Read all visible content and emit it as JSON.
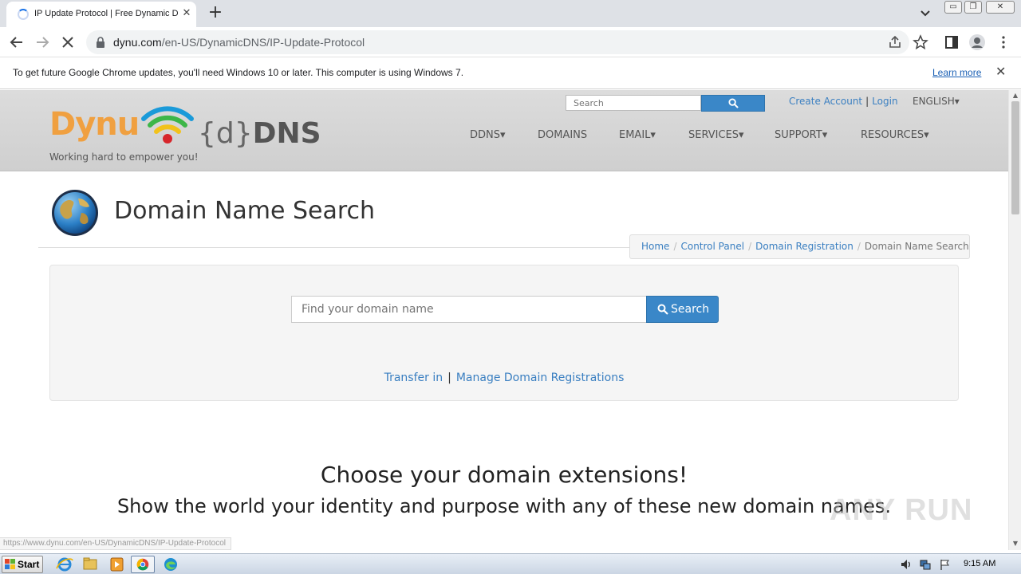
{
  "browser": {
    "tab_title": "IP Update Protocol | Free Dynamic D",
    "tab_close": "✕",
    "new_tab": "+",
    "url_host": "dynu.com",
    "url_path": "/en-US/DynamicDNS/IP-Update-Protocol",
    "window_controls": [
      "▭",
      "❐",
      "✕"
    ]
  },
  "infobar": {
    "message": "To get future Google Chrome updates, you'll need Windows 10 or later. This computer is using Windows 7.",
    "learn_more": "Learn more",
    "close": "✕"
  },
  "site": {
    "logo_word": "Dynu",
    "logo_ddns_braces": "{d}",
    "logo_ddns_text": "DNS",
    "tagline": "Working hard to empower you!",
    "search_placeholder": "Search",
    "create_account": "Create Account",
    "login": "Login",
    "link_separator": "|",
    "language": "ENGLISH▾",
    "nav": [
      "DDNS▾",
      "DOMAINS",
      "EMAIL▾",
      "SERVICES▾",
      "SUPPORT▾",
      "RESOURCES▾"
    ]
  },
  "page": {
    "title": "Domain Name Search",
    "breadcrumb": [
      "Home",
      "Control Panel",
      "Domain Registration",
      "Domain Name Search"
    ],
    "breadcrumb_separator": "/",
    "domain_placeholder": "Find your domain name",
    "search_button": "Search",
    "transfer_in": "Transfer in",
    "manage_link": "Manage Domain Registrations",
    "links_separator": "|",
    "extensions_heading": "Choose your domain extensions!",
    "extensions_sub": "Show the world your identity and purpose with any of these new domain names."
  },
  "status_bar": {
    "hover_url": "https://www.dynu.com/en-US/DynamicDNS/IP-Update-Protocol"
  },
  "watermark": {
    "text": "ANY RUN"
  },
  "taskbar": {
    "start_label": "Start",
    "clock": "9:15 AM"
  },
  "colors": {
    "link": "#3a7fc1",
    "primary_button": "#3a87c8",
    "logo_orange": "#f0a040",
    "chrome_accent": "#1a73e8"
  }
}
